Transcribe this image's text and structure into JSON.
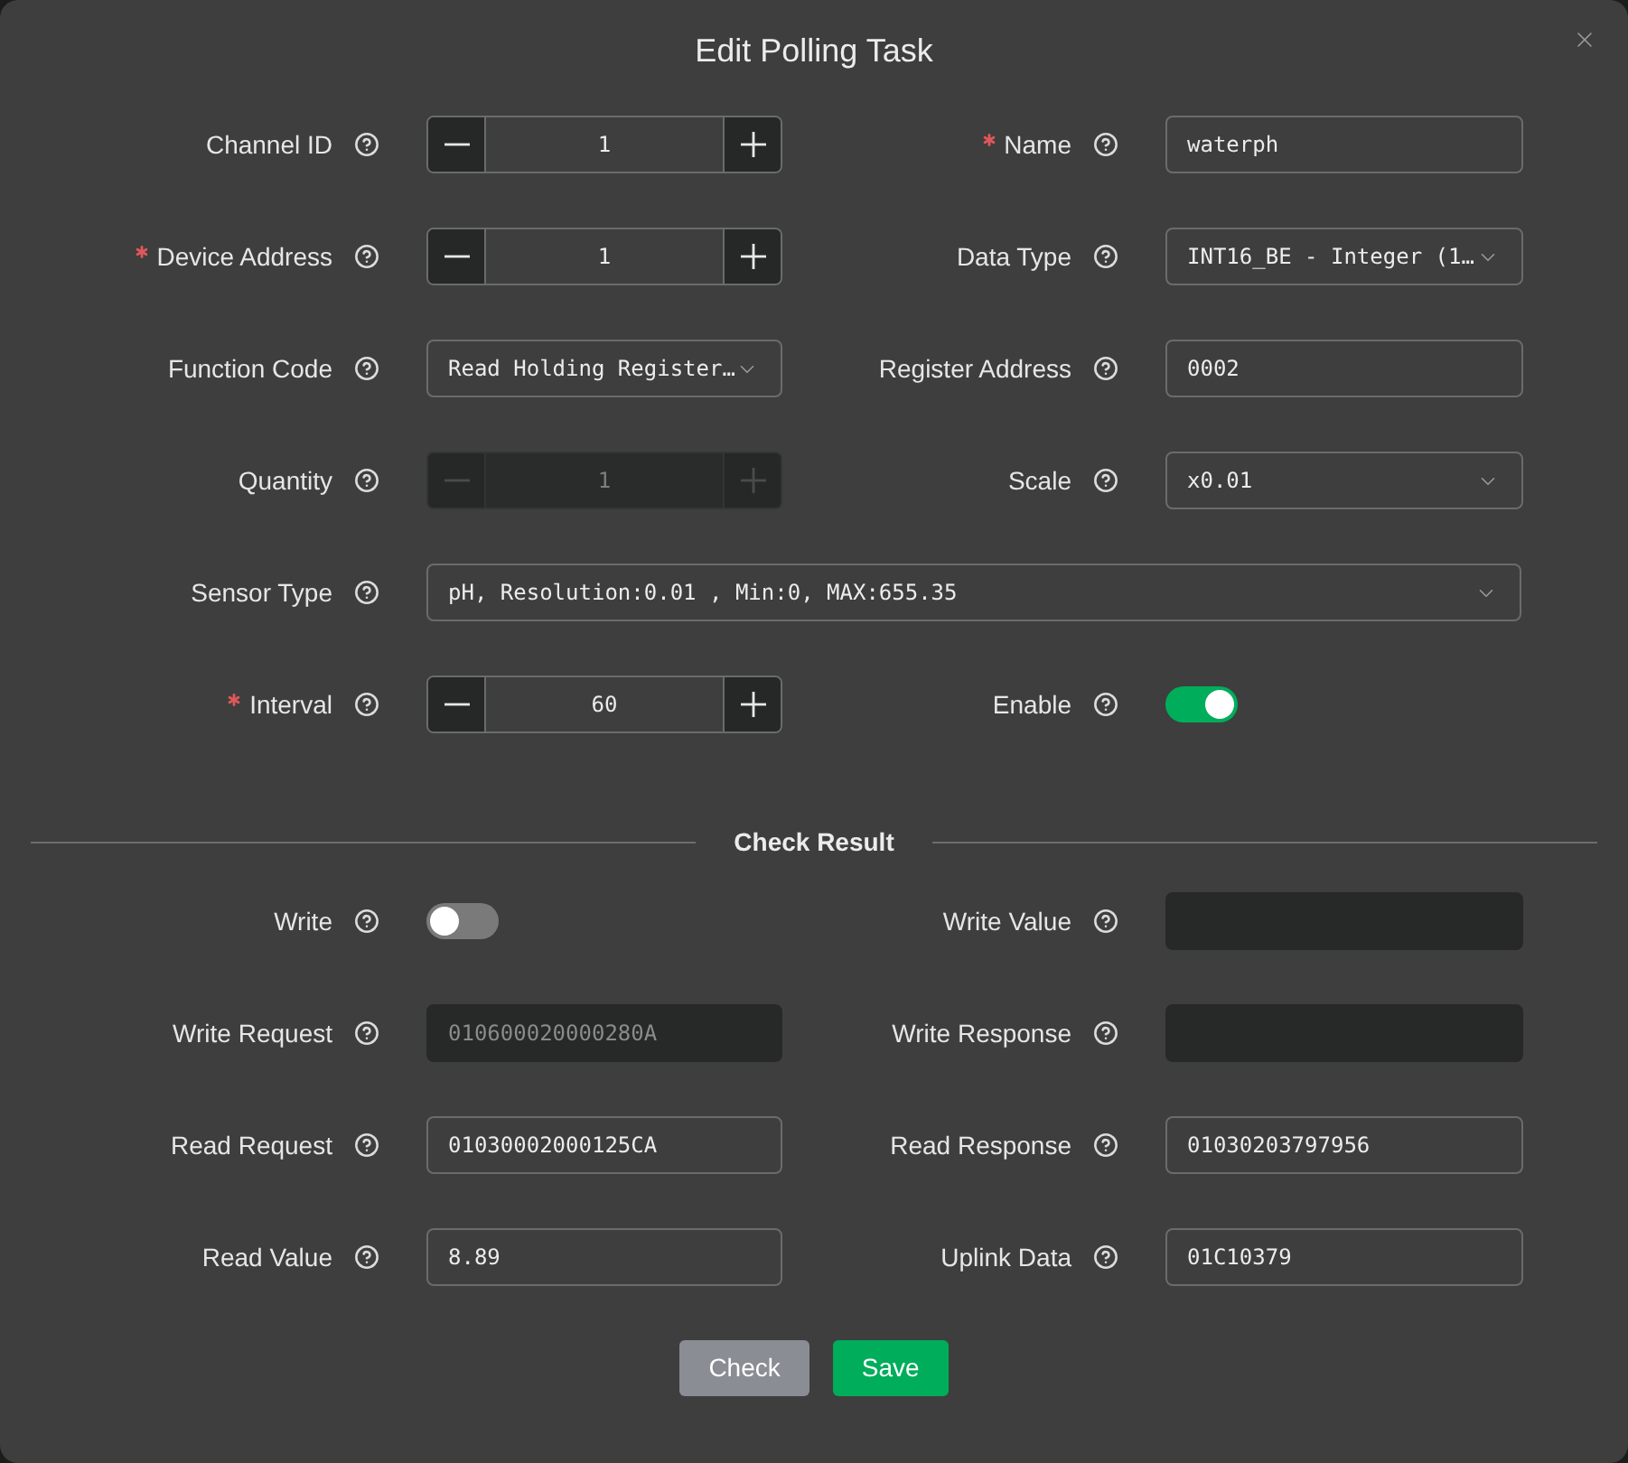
{
  "dialog": {
    "title": "Edit Polling Task"
  },
  "form": {
    "rows": [
      [
        {
          "label": "Channel ID",
          "required": false,
          "kind": "stepper",
          "value": "1",
          "disabled": false
        },
        {
          "label": "Name",
          "required": true,
          "kind": "text",
          "value": "waterph",
          "disabled": false
        }
      ],
      [
        {
          "label": "Device Address",
          "required": true,
          "kind": "stepper",
          "value": "1",
          "disabled": false
        },
        {
          "label": "Data Type",
          "required": false,
          "kind": "select",
          "value": "INT16_BE - Integer (1…"
        }
      ],
      [
        {
          "label": "Function Code",
          "required": false,
          "kind": "select",
          "value": "Read Holding Register…"
        },
        {
          "label": "Register Address",
          "required": false,
          "kind": "text",
          "value": "0002",
          "disabled": false
        }
      ],
      [
        {
          "label": "Quantity",
          "required": false,
          "kind": "stepper",
          "value": "1",
          "disabled": true
        },
        {
          "label": "Scale",
          "required": false,
          "kind": "select",
          "value": "x0.01"
        }
      ],
      [
        {
          "label": "Sensor Type",
          "required": false,
          "kind": "select",
          "value": "pH, Resolution:0.01 , Min:0, MAX:655.35"
        }
      ],
      [
        {
          "label": "Interval",
          "required": true,
          "kind": "stepper",
          "value": "60",
          "disabled": false
        },
        {
          "label": "Enable",
          "required": false,
          "kind": "switch",
          "on": true
        }
      ]
    ]
  },
  "check_result": {
    "title": "Check Result",
    "rows": [
      [
        {
          "label": "Write",
          "required": false,
          "kind": "switch",
          "on": false
        },
        {
          "label": "Write Value",
          "required": false,
          "kind": "text",
          "disabled": true
        }
      ],
      [
        {
          "label": "Write Request",
          "required": false,
          "kind": "text",
          "value": "010600020000280A",
          "disabled": true
        },
        {
          "label": "Write Response",
          "required": false,
          "kind": "text",
          "disabled": true
        }
      ],
      [
        {
          "label": "Read Request",
          "required": false,
          "kind": "text",
          "value": "01030002000125CA",
          "disabled": false
        },
        {
          "label": "Read Response",
          "required": false,
          "kind": "text",
          "value": "01030203797956",
          "disabled": false
        }
      ],
      [
        {
          "label": "Read Value",
          "required": false,
          "kind": "text",
          "value": "8.89",
          "disabled": false
        },
        {
          "label": "Uplink Data",
          "required": false,
          "kind": "text",
          "value": "01C10379",
          "disabled": false
        }
      ]
    ]
  },
  "buttons": [
    {
      "label": "Check",
      "kind": "secondary"
    },
    {
      "label": "Save",
      "kind": "primary"
    }
  ]
}
